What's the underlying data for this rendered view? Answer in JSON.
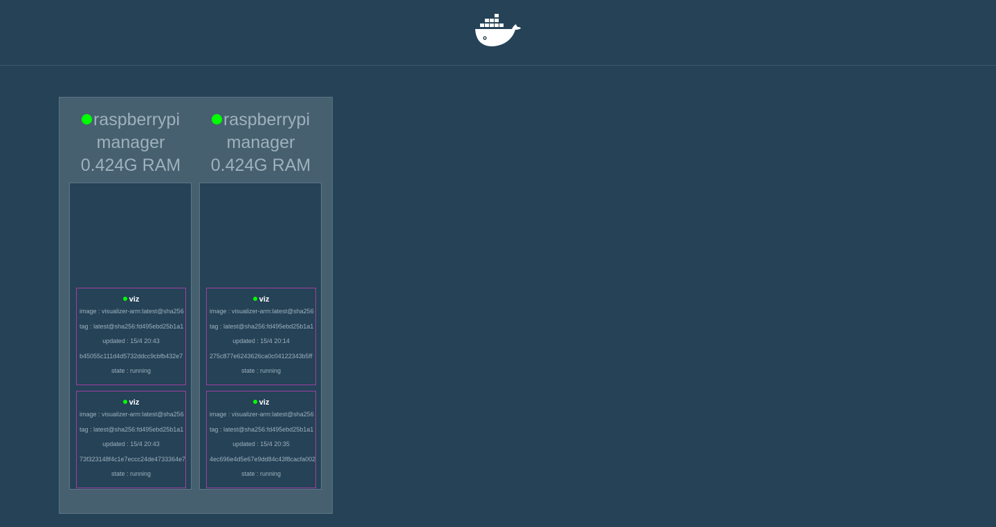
{
  "header": {
    "logo_icon": "docker-whale-icon"
  },
  "nodes": [
    {
      "name": "raspberrypi",
      "role": "manager",
      "ram": "0.424G RAM",
      "status_color": "#00ff00",
      "tasks": [
        {
          "name": "viz",
          "image": "image : visualizer-arm:latest@sha256",
          "tag": "tag : latest@sha256:fd495ebd25b1a1",
          "updated": "updated : 15/4 20:43",
          "id": "b45055c111d4d5732ddcc9cbfb432e7",
          "state": "state : running"
        },
        {
          "name": "viz",
          "image": "image : visualizer-arm:latest@sha256",
          "tag": "tag : latest@sha256:fd495ebd25b1a1",
          "updated": "updated : 15/4 20:43",
          "id": "73f323148f4c1e7eccc24de4733364e7",
          "state": "state : running"
        }
      ]
    },
    {
      "name": "raspberrypi",
      "role": "manager",
      "ram": "0.424G RAM",
      "status_color": "#00ff00",
      "tasks": [
        {
          "name": "viz",
          "image": "image : visualizer-arm:latest@sha256",
          "tag": "tag : latest@sha256:fd495ebd25b1a1",
          "updated": "updated : 15/4 20:14",
          "id": "275c877e6243626ca0c04122343b5ff",
          "state": "state : running"
        },
        {
          "name": "viz",
          "image": "image : visualizer-arm:latest@sha256",
          "tag": "tag : latest@sha256:fd495ebd25b1a1",
          "updated": "updated : 15/4 20:35",
          "id": "4ec696e4d5e67e9dd84c43f8cacfa002",
          "state": "state : running"
        }
      ]
    }
  ]
}
